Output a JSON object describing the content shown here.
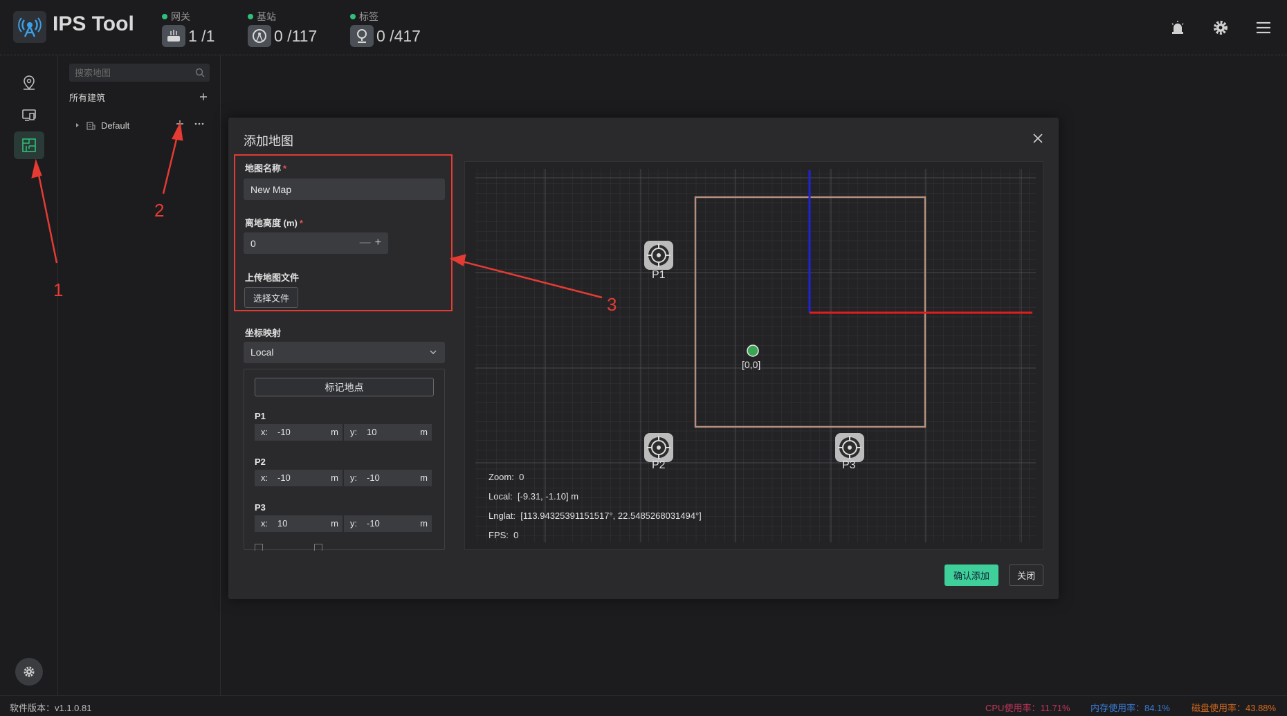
{
  "app": {
    "title": "IPS Tool",
    "colors": {
      "accent": "#3ecf9a",
      "online": "#2fbf7a",
      "annotation": "#e53b33"
    }
  },
  "header": {
    "stats": [
      {
        "label": "网关",
        "value": "1 /1",
        "icon": "gateway-icon"
      },
      {
        "label": "基站",
        "value": "0 /117",
        "icon": "base-station-icon"
      },
      {
        "label": "标签",
        "value": "0 /417",
        "icon": "tag-icon"
      }
    ],
    "right_icons": [
      "alarm-icon",
      "settings-icon",
      "menu-icon"
    ]
  },
  "rail": {
    "items": [
      "map-pin-icon",
      "devices-icon",
      "building-map-icon"
    ],
    "active_index": 2
  },
  "tree": {
    "search_placeholder": "搜索地图",
    "all_buildings": "所有建筑",
    "default_building": "Default"
  },
  "dialog": {
    "title": "添加地图",
    "map_name": {
      "label": "地图名称",
      "value": "New Map"
    },
    "height": {
      "label": "离地高度 (m)",
      "value": "0"
    },
    "upload": {
      "label": "上传地图文件",
      "button": "选择文件"
    },
    "coord": {
      "label": "坐标映射",
      "value": "Local"
    },
    "mark_button": "标记地点",
    "points": [
      {
        "name": "P1",
        "x": "-10",
        "y": "10"
      },
      {
        "name": "P2",
        "x": "-10",
        "y": "-10"
      },
      {
        "name": "P3",
        "x": "10",
        "y": "-10"
      }
    ],
    "axis_labels": {
      "x": "x:",
      "y": "y:",
      "unit": "m"
    },
    "confirm": "确认添加",
    "close": "关闭"
  },
  "canvas": {
    "origin_label": "[0,0]",
    "markers": [
      "P1",
      "P2",
      "P3"
    ],
    "info": {
      "zoom_label": "Zoom:",
      "zoom": "0",
      "local_label": "Local:",
      "local": "[-9.31, -1.10] m",
      "lnglat_label": "Lnglat:",
      "lnglat": "[113.94325391151517°, 22.5485268031494°]",
      "fps_label": "FPS:",
      "fps": "0"
    }
  },
  "annotations": [
    "1",
    "2",
    "3"
  ],
  "status": {
    "version": "软件版本：v1.1.0.81",
    "cpu": "CPU使用率：11.71%",
    "memory": "内存使用率：84.1%",
    "disk": "磁盘使用率：43.88%",
    "colors": {
      "cpu": "#c0365a",
      "memory": "#3a7bd5",
      "disk": "#d2691e"
    }
  }
}
